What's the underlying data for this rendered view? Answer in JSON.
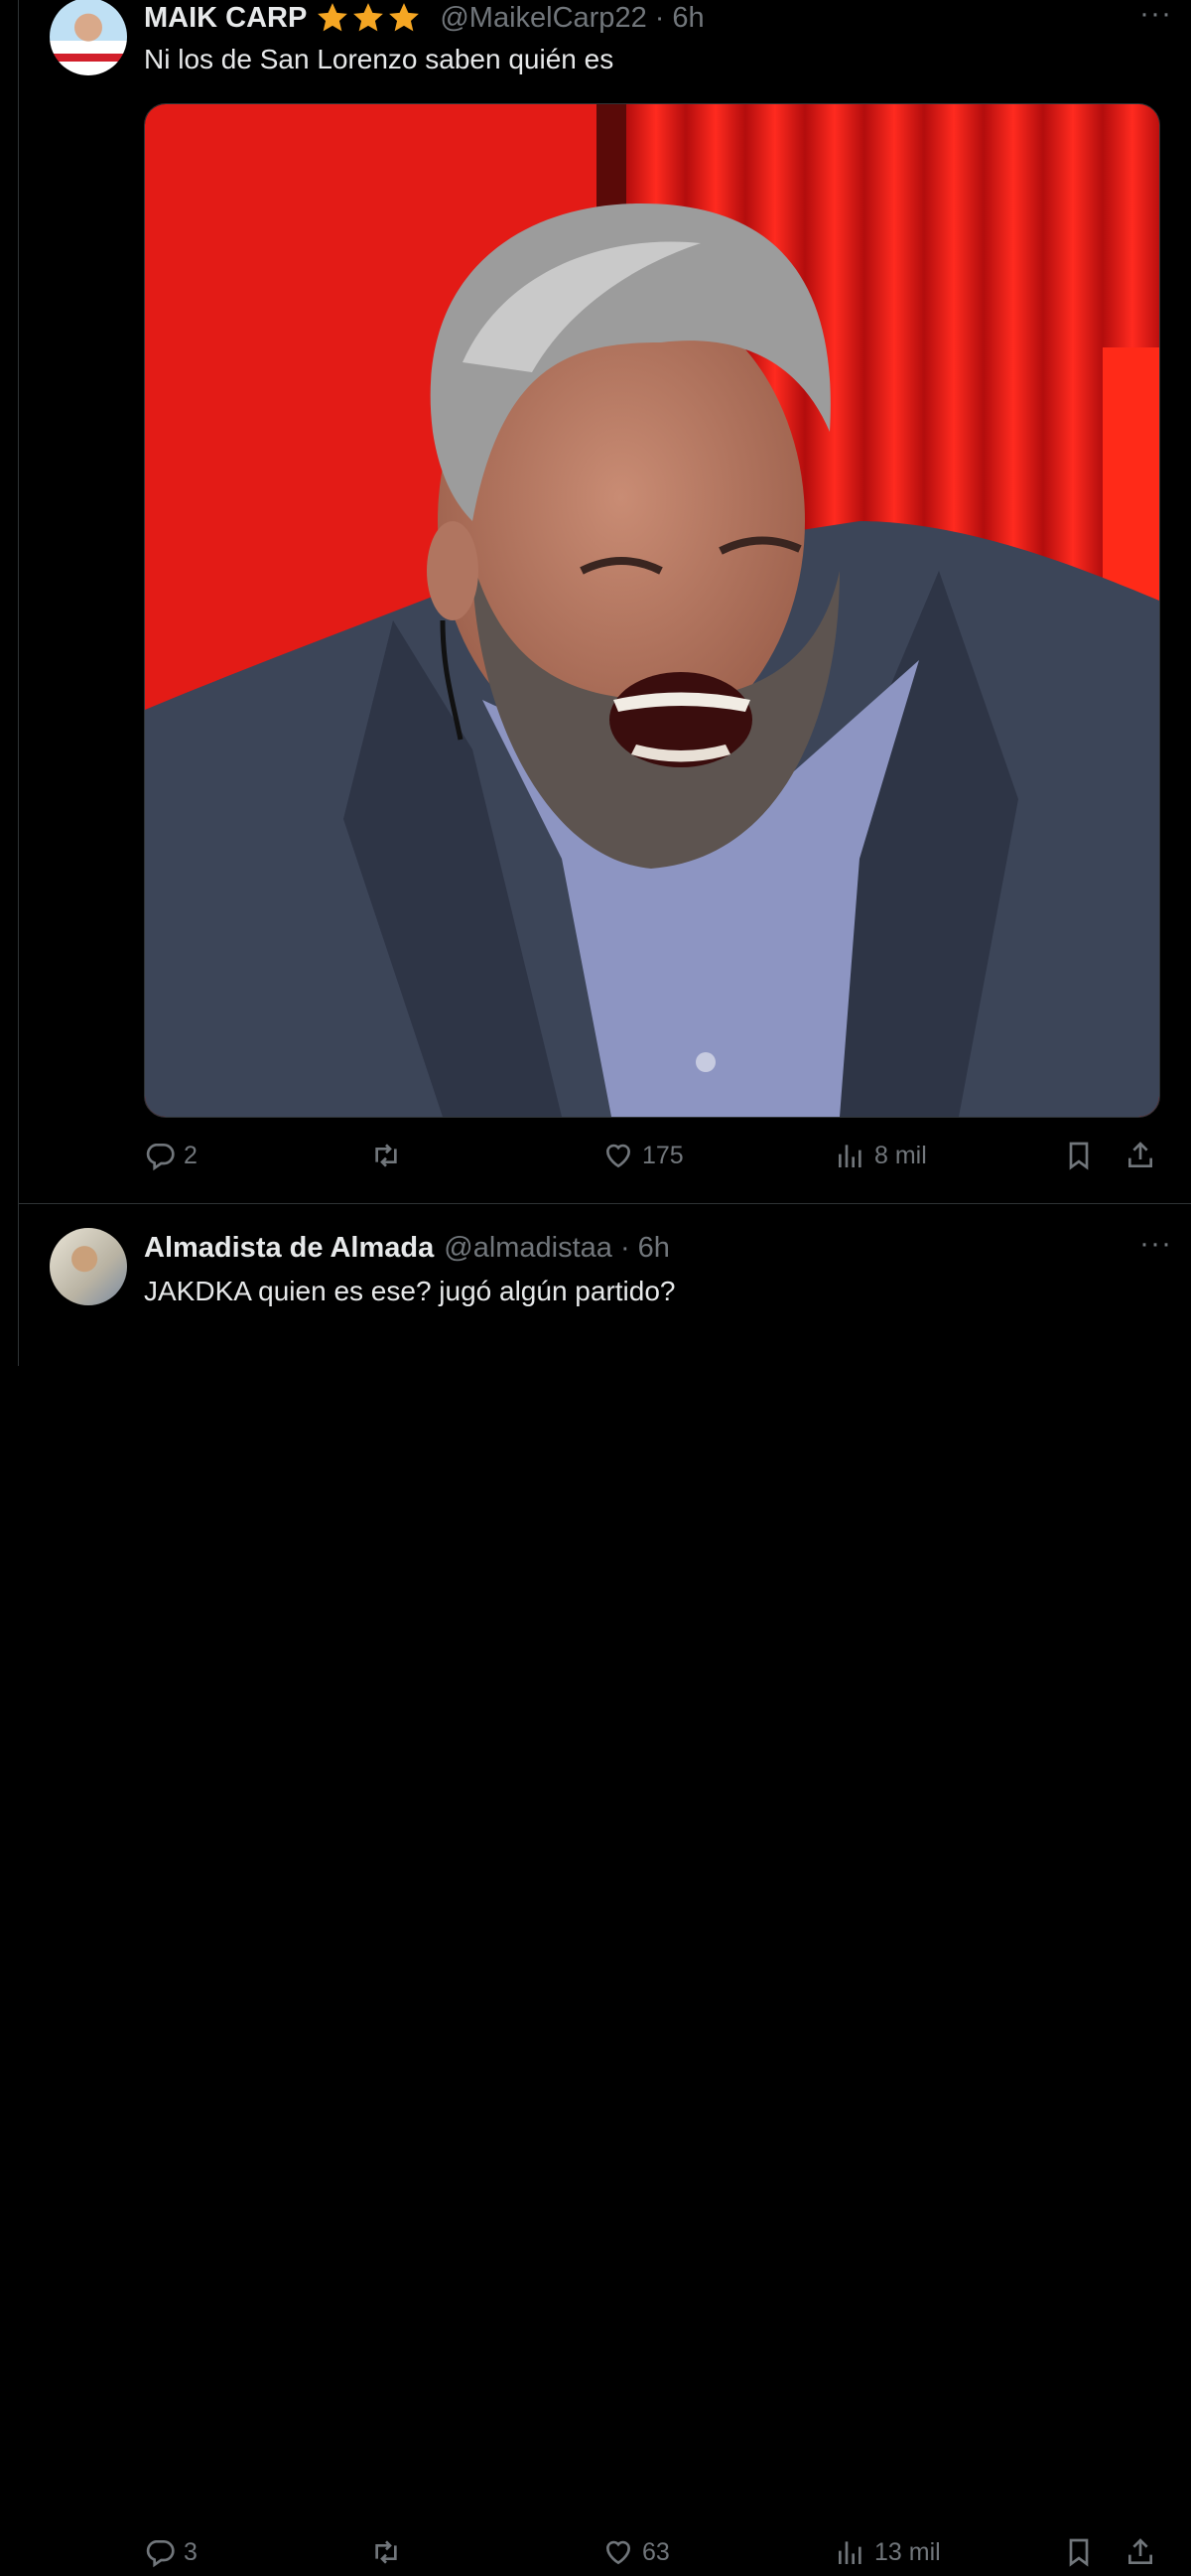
{
  "colors": {
    "background": "#000000",
    "text_primary": "#e7e9ea",
    "text_secondary": "#71767b",
    "divider": "#2f3336",
    "star": "#f5a623"
  },
  "tweets": [
    {
      "author_name": "MAIK CARP",
      "badge_stars": 3,
      "handle": "@MaikelCarp22",
      "separator": "·",
      "time": "6h",
      "more": "···",
      "text": "Ni los de San Lorenzo saben quién es",
      "has_media": true,
      "actions": {
        "replies": "2",
        "retweets": "",
        "likes": "175",
        "views": "8 mil"
      },
      "icons": [
        "reply-icon",
        "retweet-icon",
        "like-icon",
        "views-icon",
        "bookmark-icon",
        "share-icon"
      ]
    },
    {
      "author_name": "Almadista de Almada",
      "handle": "@almadistaa",
      "separator": "·",
      "time": "6h",
      "more": "···",
      "text": "JAKDKA quien es ese? jugó algún partido?",
      "has_media": false,
      "actions": {
        "replies": "3",
        "retweets": "",
        "likes": "63",
        "views": "13 mil"
      },
      "icons": [
        "reply-icon",
        "retweet-icon",
        "like-icon",
        "views-icon",
        "bookmark-icon",
        "share-icon"
      ]
    }
  ]
}
